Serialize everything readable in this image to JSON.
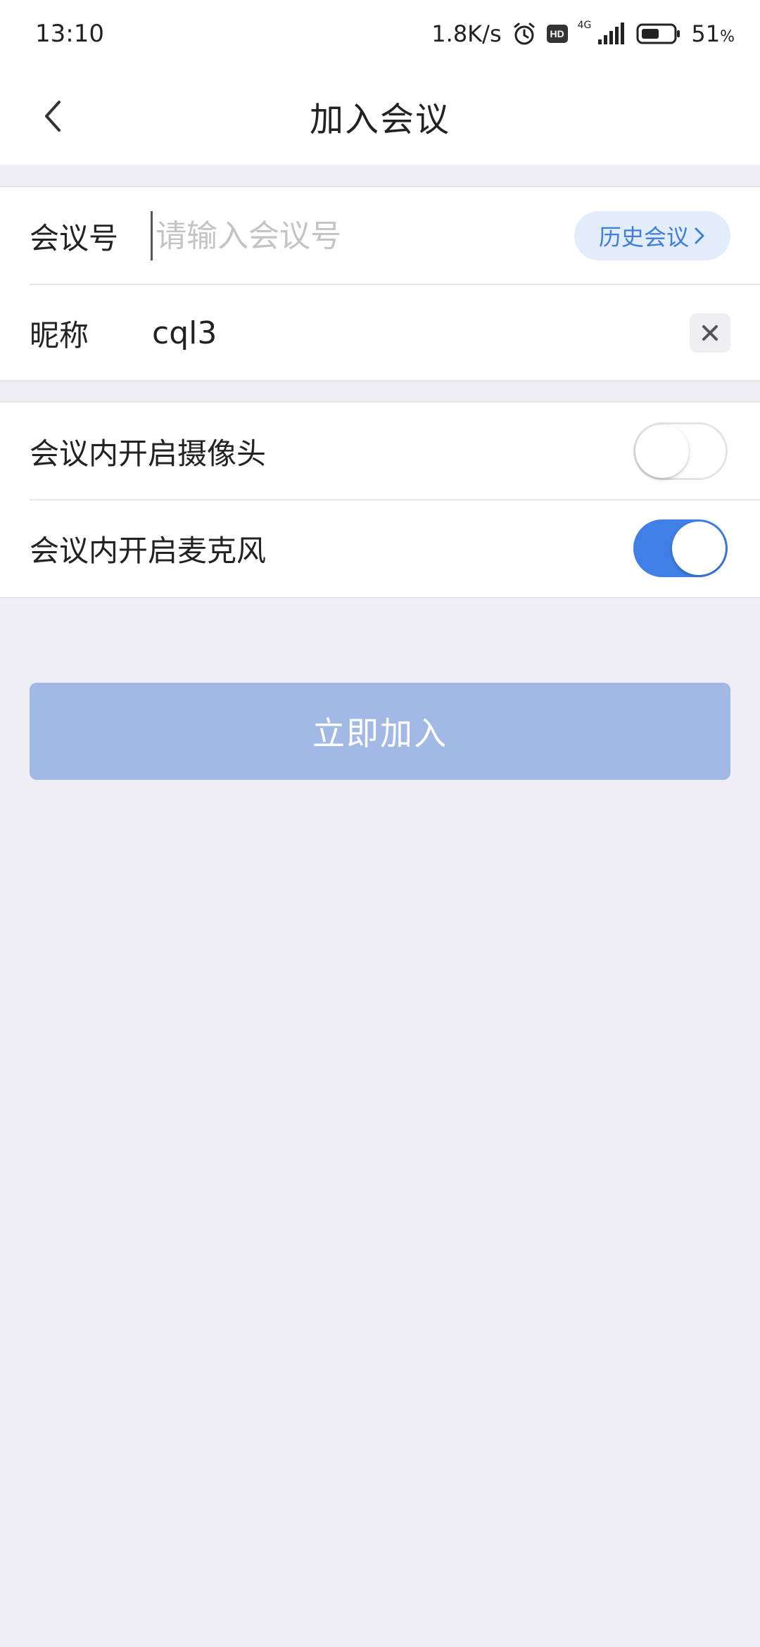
{
  "status_bar": {
    "time": "13:10",
    "net_speed": "1.8K/s",
    "hd_label": "HD",
    "network_type": "4G",
    "battery_number": "51",
    "battery_unit": "%",
    "icons": [
      "alarm-icon",
      "signal-icon",
      "battery-icon"
    ]
  },
  "header": {
    "title": "加入会议",
    "back_icon": "chevron-left-icon"
  },
  "form": {
    "meeting_id": {
      "label": "会议号",
      "value": "",
      "placeholder": "请输入会议号",
      "history_label": "历史会议"
    },
    "nickname": {
      "label": "昵称",
      "value": "cql3"
    }
  },
  "settings": {
    "camera": {
      "label": "会议内开启摄像头",
      "enabled": false
    },
    "microphone": {
      "label": "会议内开启麦克风",
      "enabled": true
    }
  },
  "actions": {
    "join_label": "立即加入"
  },
  "colors": {
    "accent": "#3f7fe6",
    "button_disabled": "#a2b9e5",
    "page_background": "#eeeef4"
  }
}
